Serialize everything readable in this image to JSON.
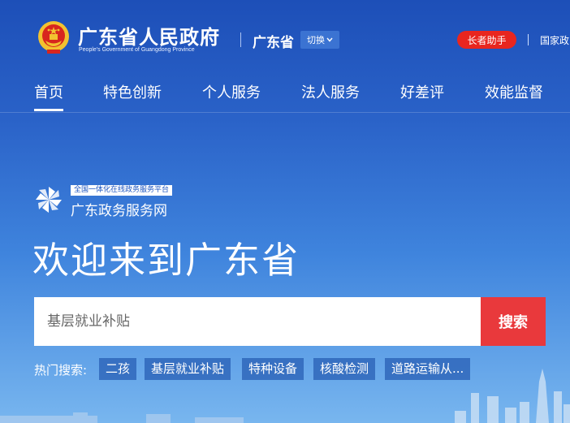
{
  "header": {
    "site_title": "广东省人民政府",
    "site_subtitle": "People's Government of Guangdong Province",
    "region": "广东省",
    "switch_label": "切换",
    "elder_mode_label": "长者助手",
    "national_link": "国家政"
  },
  "nav": {
    "items": [
      {
        "label": "首页",
        "active": true
      },
      {
        "label": "特色创新"
      },
      {
        "label": "个人服务"
      },
      {
        "label": "法人服务"
      },
      {
        "label": "好差评"
      },
      {
        "label": "效能监督"
      }
    ]
  },
  "hero": {
    "platform_tag": "全国一体化在线政务服务平台",
    "platform_name": "广东政务服务网",
    "welcome": "欢迎来到广东省"
  },
  "search": {
    "placeholder": "基层就业补贴",
    "button_label": "搜索"
  },
  "hot_search": {
    "label": "热门搜索:",
    "tags": [
      "二孩",
      "基层就业补贴",
      "特种设备",
      "核酸检测",
      "道路运输从..."
    ]
  },
  "colors": {
    "accent_red": "#e9393c",
    "elder_red": "#e8261f",
    "brand_blue": "#1d4fb8"
  }
}
